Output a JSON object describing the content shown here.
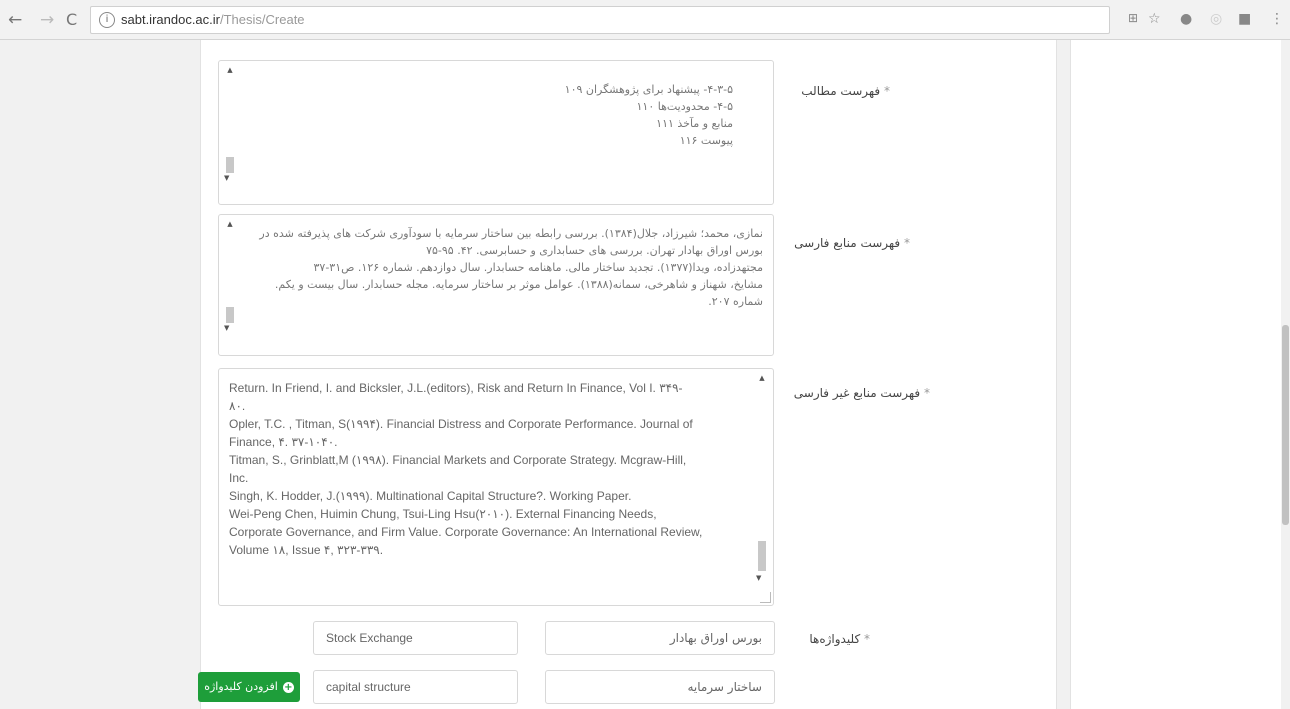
{
  "browser": {
    "url_domain": "sabt.irandoc.ac.ir",
    "url_path": "/Thesis/Create"
  },
  "icons": {
    "back": "back-arrow-icon",
    "forward": "forward-arrow-icon",
    "reload": "reload-icon",
    "info": "info-icon",
    "translate": "translate-icon",
    "star": "star-icon",
    "menu": "kebab-menu-icon"
  },
  "form": {
    "toc": {
      "label": "فهرست مطالب",
      "required": "*",
      "text": "۴-۳-۵- پیشنهاد برای پژوهشگران ۱۰۹\n۴-۵- محدودیت‌ها ۱۱۰\nمنابع و مآخذ ۱۱۱\nپیوست ۱۱۶"
    },
    "persian_refs": {
      "label": "فهرست منابع فارسی",
      "required": "*",
      "text": "نمازی، محمد؛ شیرزاد، جلال(۱۳۸۴). بررسی رابطه بین ساختار سرمایه با سودآوری شرکت های پذیرفته شده در بورس اوراق بهادار تهران. بررسی های حسابداری و حسابرسی. ۴۲. ۹۵-۷۵\nمجتهدزاده، ویدا(۱۳۷۷). تجدید ساختار مالی. ماهنامه حسابدار. سال دوازدهم. شماره ۱۲۶. ص۳۱-۳۷\nمشایخ، شهناز و شاهرخی، سمانه(۱۳۸۸). عوامل موثر بر ساختار سرمایه. مجله حسابدار. سال بیست و یکم. شماره ۲۰۷."
    },
    "foreign_refs": {
      "label": "فهرست منابع غیر فارسی",
      "required": "*",
      "text": "Return. In Friend, I. and Bicksler, J.L.(editors), Risk and Return In Finance, Vol I. ۳۴۹-\n۸۰.\nOpler, T.C. , Titman, S(۱۹۹۴). Financial Distress and Corporate Performance. Journal of\nFinance, ۴. ۳۷-۱۰۴۰.\nTitman, S., Grinblatt,M (۱۹۹۸). Financial Markets and Corporate Strategy. Mcgraw-Hill,\nInc.\nSingh, K. Hodder, J.(۱۹۹۹). Multinational Capital Structure?. Working Paper.\nWei-Peng Chen, Huimin Chung, Tsui-Ling Hsu(۲۰۱۰). External Financing Needs,\nCorporate Governance, and Firm Value. Corporate Governance: An International Review,\nVolume ۱۸, Issue ۴, ۳۲۳-۳۳۹."
    },
    "keywords": {
      "label": "کلیدواژه‌ها",
      "required": "*",
      "rows": [
        {
          "fa": "بورس اوراق بهادار",
          "en": "Stock Exchange"
        },
        {
          "fa": "ساختار سرمایه",
          "en": "capital structure"
        }
      ],
      "add_button": "افزودن کلیدواژه",
      "add_icon": "plus-circle-icon"
    }
  }
}
